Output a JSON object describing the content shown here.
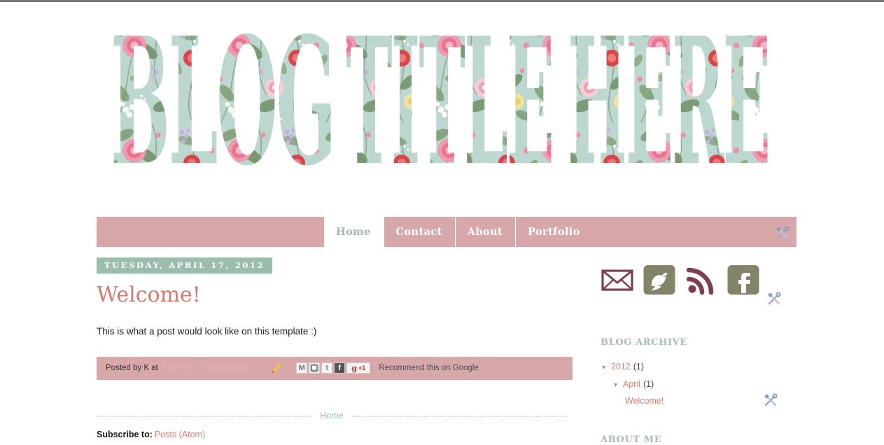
{
  "header": {
    "blog_title": "BLOG TITLE HERE",
    "title_words": [
      "BLOG",
      "TITLE",
      "HERE"
    ],
    "style_note": "floral-pattern-letters"
  },
  "colors": {
    "nav_bar_pink": "#d8a7a9",
    "date_banner_sage": "#9cbdad",
    "post_title_salmon": "#d17a70",
    "link_salmon": "#d9817a",
    "widget_title_sage": "#a8bcb0",
    "floral_bg_mint": "#b9d4cc",
    "rose_pink": "#e87f96",
    "leaf_green": "#6f8f63"
  },
  "nav": {
    "items": [
      {
        "label": "Home",
        "active": true
      },
      {
        "label": "Contact",
        "active": false
      },
      {
        "label": "About",
        "active": false
      },
      {
        "label": "Portfolio",
        "active": false
      }
    ],
    "edit_icon": "wrench-screwdriver-icon"
  },
  "post": {
    "date": "TUESDAY, APRIL 17, 2012",
    "title": "Welcome!",
    "body": "This is what a post would look like on this template :)",
    "footer": {
      "posted_by": "Posted by K at",
      "time": "7:35 PM",
      "comments": "0 comments",
      "edit_icon": "pencil-icon",
      "share_icons": [
        {
          "name": "gmail-share-icon",
          "glyph": "M"
        },
        {
          "name": "blogger-share-icon",
          "glyph": "B"
        },
        {
          "name": "twitter-share-icon",
          "glyph": "t"
        },
        {
          "name": "facebook-share-icon",
          "glyph": "f"
        }
      ],
      "gplus_g": "g",
      "gplus_plus_one": "+1",
      "recommend": "Recommend this on Google"
    }
  },
  "footer": {
    "home_link": "Home",
    "subscribe_label": "Subscribe to:",
    "subscribe_link": "Posts (Atom)"
  },
  "sidebar": {
    "social": [
      {
        "name": "email-icon",
        "title": "Email"
      },
      {
        "name": "twitter-icon",
        "title": "Twitter"
      },
      {
        "name": "rss-icon",
        "title": "RSS"
      },
      {
        "name": "facebook-icon",
        "title": "Facebook"
      }
    ],
    "archive": {
      "title": "BLOG ARCHIVE",
      "rows": [
        {
          "triangle": "▼",
          "link": "2012",
          "count": "(1)",
          "level": 1
        },
        {
          "triangle": "▼",
          "link": "April",
          "count": "(1)",
          "level": 2
        },
        {
          "triangle": "",
          "link": "Welcome!",
          "count": "",
          "level": 3
        }
      ]
    },
    "about": {
      "title": "ABOUT ME"
    },
    "edit_icon": "wrench-screwdriver-icon"
  }
}
